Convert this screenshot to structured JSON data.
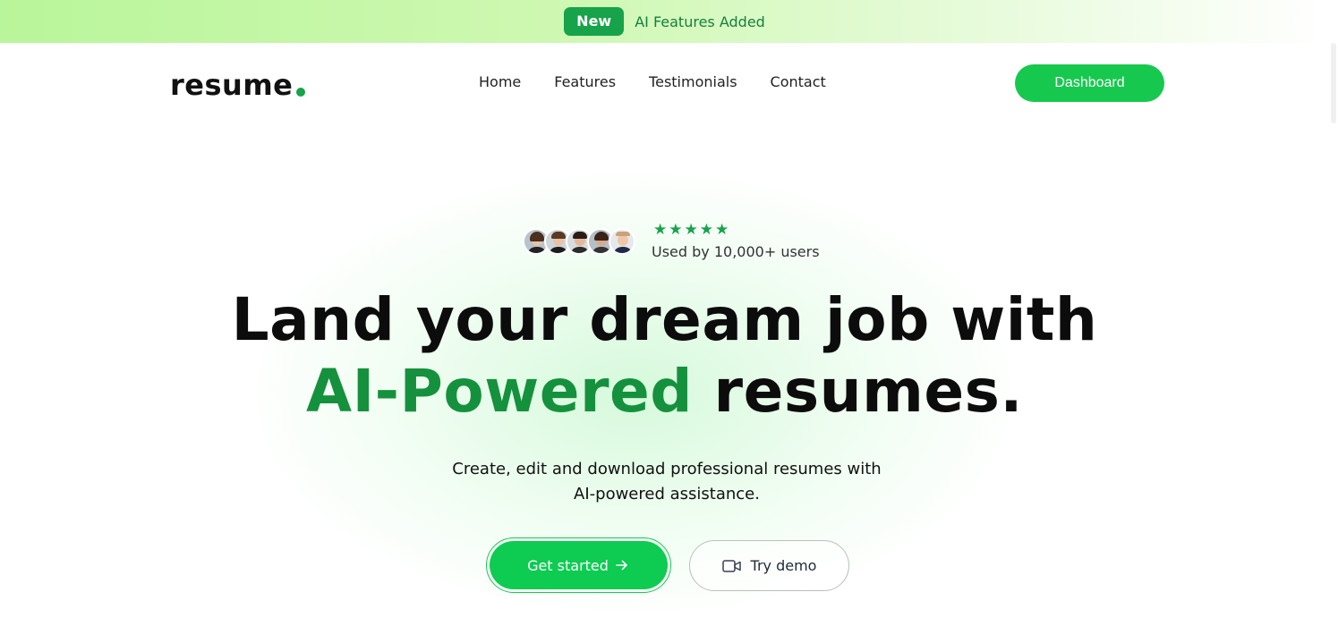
{
  "banner": {
    "badge": "New",
    "message": "AI Features Added"
  },
  "nav": {
    "logo": "resume",
    "links": [
      "Home",
      "Features",
      "Testimonials",
      "Contact"
    ],
    "dashboard_label": "Dashboard"
  },
  "social_proof": {
    "rating_stars": 5,
    "text": "Used by 10,000+ users"
  },
  "hero": {
    "title_line1": "Land your dream job with",
    "title_accent": "AI-Powered",
    "title_rest": " resumes.",
    "subtitle_line1": "Create, edit and download professional resumes with",
    "subtitle_line2": "AI-powered assistance.",
    "primary_cta": "Get started",
    "primary_cta_icon": "arrow-right-icon",
    "secondary_cta": "Try demo",
    "secondary_cta_icon": "video-camera-icon"
  },
  "colors": {
    "accent": "#16a34a",
    "button": "#16c94e",
    "heading_accent": "#15913d"
  }
}
